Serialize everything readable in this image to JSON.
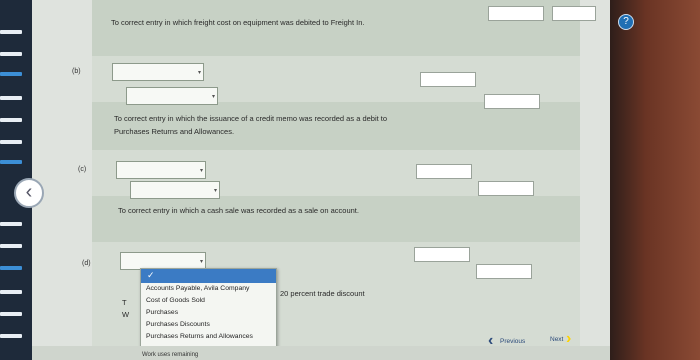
{
  "entries": [
    {
      "label": "",
      "prompt": "To correct entry in which freight cost on equipment was debited to Freight In."
    },
    {
      "label": "(b)",
      "prompt": "To correct entry in which the issuance of a credit memo was recorded as a debit to Purchases Returns and Allowances."
    },
    {
      "label": "(c)",
      "prompt": "To correct entry in which a cash sale was recorded as a sale on account."
    },
    {
      "label": "(d)",
      "prompt": "20 percent trade discount"
    }
  ],
  "partial_text": {
    "t": "T",
    "w": "W"
  },
  "dropdown": {
    "options": [
      "Accounts Payable, Avila Company",
      "Cost of Goods Sold",
      "Purchases",
      "Purchases Discounts",
      "Purchases Returns and Allowances"
    ]
  },
  "footer": {
    "remaining": "Work uses remaining",
    "previous": "Previous",
    "next": "Next"
  },
  "icons": {
    "back": "chevron-left-icon",
    "help": "help-icon",
    "check": "checkmark-icon"
  },
  "colors": {
    "accent": "#3b7bc4",
    "next_chevron": "#ffd400"
  }
}
